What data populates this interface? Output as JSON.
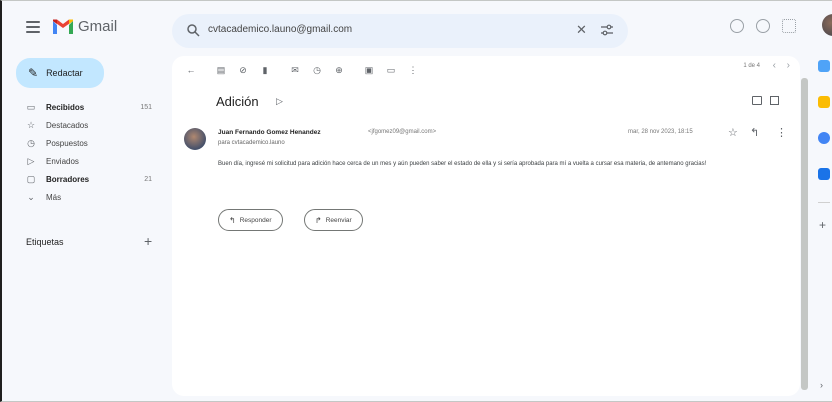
{
  "app": {
    "logo_text": "Gmail"
  },
  "search": {
    "query": "cvtacademico.launo@gmail.com"
  },
  "sidebar": {
    "compose_label": "Redactar",
    "items": [
      {
        "label": "Recibidos",
        "count": "151",
        "bold": true,
        "icon": "inbox-icon"
      },
      {
        "label": "Destacados",
        "count": "",
        "bold": false,
        "icon": "star-icon"
      },
      {
        "label": "Pospuestos",
        "count": "",
        "bold": false,
        "icon": "clock-icon"
      },
      {
        "label": "Enviados",
        "count": "",
        "bold": false,
        "icon": "send-icon"
      },
      {
        "label": "Borradores",
        "count": "21",
        "bold": true,
        "icon": "draft-icon"
      },
      {
        "label": "Más",
        "count": "",
        "bold": false,
        "icon": "chevron-down-icon"
      }
    ],
    "labels_heading": "Etiquetas"
  },
  "toolbar": {
    "pager": "1 de 4"
  },
  "email": {
    "subject": "Adición",
    "sender_name": "Juan Fernando Gomez Henandez",
    "sender_email": "<jfgomez09@gmail.com>",
    "to": "para cvtacademico.launo",
    "date": "mar, 28 nov 2023, 18:15",
    "body": "Buen día, ingresé mi solicitud para adición hace cerca de un mes y aún pueden saber el estado de ella y si sería aprobada para mí a vuelta a cursar esa materia, de antemano gracias!",
    "reply_label": "Responder",
    "forward_label": "Reenviar"
  },
  "colors": {
    "compose_bg": "#c2e7ff",
    "search_bg": "#eaf1fb",
    "page_bg": "#f6f8fc"
  }
}
